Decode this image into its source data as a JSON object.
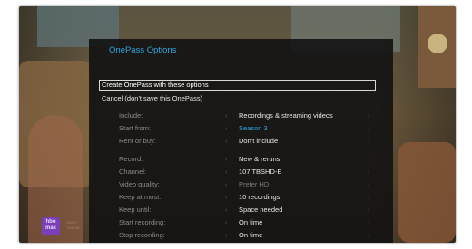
{
  "panel": {
    "title": "OnePass Options",
    "create_label": "Create OnePass with these options",
    "cancel_label": "Cancel (don't save this OnePass)"
  },
  "options": [
    {
      "label": "Include:",
      "value": "Recordings & streaming videos"
    },
    {
      "label": "Start from:",
      "value": "Season 3"
    },
    {
      "label": "Rent or buy:",
      "value": "Don't include"
    },
    {
      "label": "Record:",
      "value": "New & reruns"
    },
    {
      "label": "Channel:",
      "value": "107 TBSHD-E"
    },
    {
      "label": "Video quality:",
      "value": "Prefer HD"
    },
    {
      "label": "Keep at most:",
      "value": "10 recordings"
    },
    {
      "label": "Keep until:",
      "value": "Space needed"
    },
    {
      "label": "Start recording:",
      "value": "On time"
    },
    {
      "label": "Stop recording:",
      "value": "On time"
    }
  ],
  "arrows": {
    "left": "‹",
    "right": "›"
  },
  "logo": {
    "line1": "hbo",
    "line2": "max",
    "sub": "USER TOMOR"
  },
  "colors": {
    "accent": "#2fa4dd",
    "panel_bg": "#121212"
  }
}
